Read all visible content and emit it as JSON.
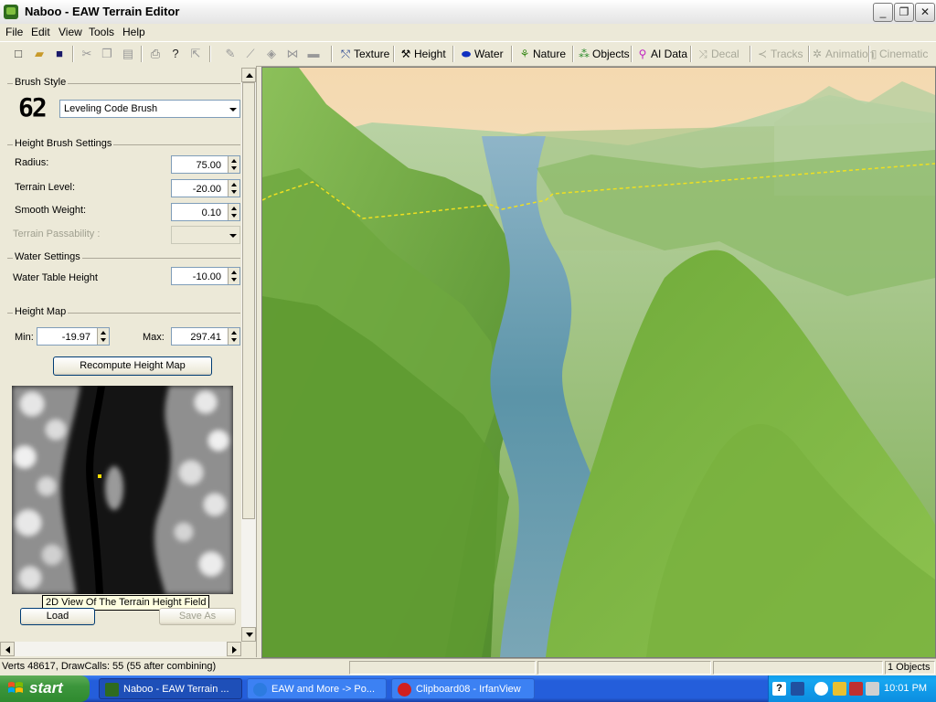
{
  "window": {
    "title": "Naboo - EAW Terrain Editor",
    "controls": {
      "minimize": "_",
      "maximize": "❐",
      "close": "✕"
    }
  },
  "menu": [
    "File",
    "Edit",
    "View",
    "Tools",
    "Help"
  ],
  "toolbar": {
    "modes": [
      {
        "label": "Texture",
        "icon": "texture-brush-icon",
        "enabled": true
      },
      {
        "label": "Height",
        "icon": "height-tools-icon",
        "enabled": true
      },
      {
        "label": "Water",
        "icon": "water-drop-icon",
        "enabled": true
      },
      {
        "label": "Nature",
        "icon": "plant-icon",
        "enabled": true
      },
      {
        "label": "Objects",
        "icon": "objects-icon",
        "enabled": true
      },
      {
        "label": "AI Data",
        "icon": "ai-pin-icon",
        "enabled": true
      },
      {
        "label": "Decal",
        "icon": "decal-icon",
        "enabled": false
      },
      {
        "label": "Tracks",
        "icon": "tracks-icon",
        "enabled": false
      },
      {
        "label": "Animation",
        "icon": "animation-icon",
        "enabled": false
      },
      {
        "label": "Cinematic",
        "icon": "cinematic-icon",
        "enabled": false
      }
    ]
  },
  "brush_style": {
    "group": "Brush Style",
    "glyph": "62",
    "selected": "Leveling Code Brush"
  },
  "height_brush": {
    "group": "Height Brush Settings",
    "radius_label": "Radius:",
    "radius": "75.00",
    "terrain_level_label": "Terrain Level:",
    "terrain_level": "-20.00",
    "smooth_weight_label": "Smooth Weight:",
    "smooth_weight": "0.10",
    "passability_label": "Terrain Passability :"
  },
  "water": {
    "group": "Water Settings",
    "table_height_label": "Water Table Height",
    "table_height": "-10.00"
  },
  "height_map": {
    "group": "Height Map",
    "min_label": "Min:",
    "min": "-19.97",
    "max_label": "Max:",
    "max": "297.41",
    "recompute_label": "Recompute Height Map",
    "tooltip": "2D View Of The Terrain Height Field",
    "load_label": "Load",
    "save_as_label": "Save As"
  },
  "status": {
    "verts": "Verts 48617, DrawCalls: 55 (55 after combining)",
    "objects": "1 Objects"
  },
  "taskbar": {
    "start": "start",
    "tasks": [
      {
        "label": "Naboo - EAW Terrain ...",
        "active": true,
        "color": "#2f6b1e"
      },
      {
        "label": "EAW and More -> Po...",
        "active": false,
        "color": "#2c7be0"
      },
      {
        "label": "Clipboard08 - IrfanView",
        "active": false,
        "color": "#d02020"
      }
    ],
    "clock": "10:01 PM"
  }
}
